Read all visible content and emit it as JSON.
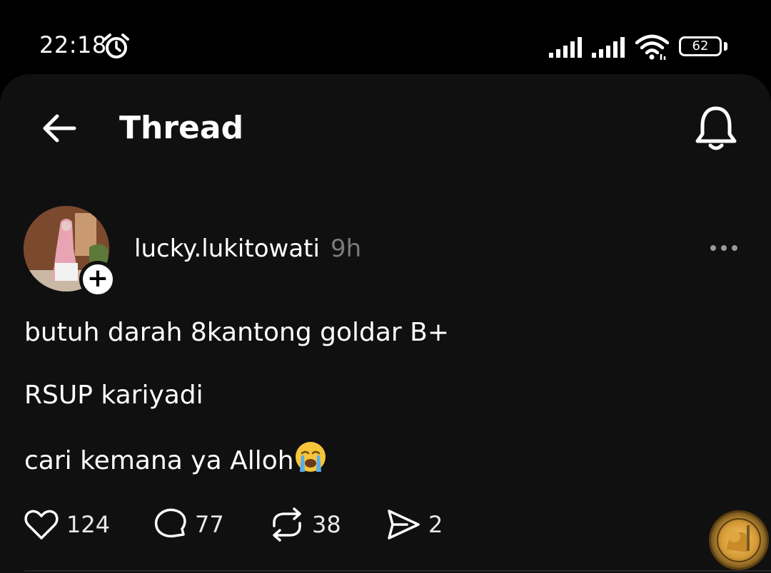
{
  "status_bar": {
    "time": "22:18",
    "battery": "62"
  },
  "header": {
    "title": "Thread"
  },
  "post": {
    "username": "lucky.lukitowati",
    "time_ago": "9h",
    "lines": [
      "butuh darah 8kantong goldar B+",
      "RSUP kariyadi",
      "cari kemana ya Alloh"
    ],
    "actions": {
      "likes": "124",
      "replies": "77",
      "reposts": "38",
      "shares": "2"
    }
  },
  "colors": {
    "background": "#101010",
    "statusbar": "#000000",
    "muted_text": "#7a7a7a",
    "text": "#ffffff"
  },
  "icons": [
    "alarm-icon",
    "signal-icon",
    "wifi-icon",
    "battery-icon",
    "back-arrow-icon",
    "bell-icon",
    "more-icon",
    "plus-icon",
    "heart-icon",
    "comment-icon",
    "repost-icon",
    "send-icon",
    "crying-face-emoji"
  ]
}
